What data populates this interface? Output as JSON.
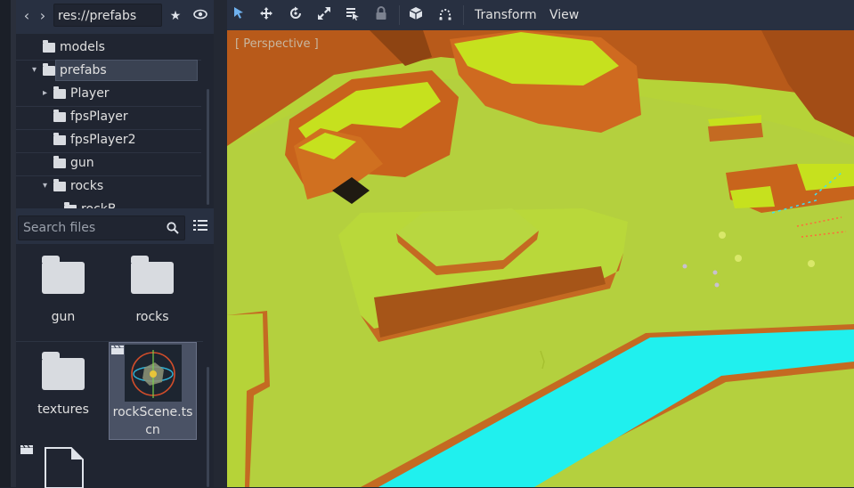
{
  "filesystem": {
    "path": "res://prefabs",
    "tree": [
      {
        "label": "models",
        "depth": 0,
        "expanded": null,
        "selected": false
      },
      {
        "label": "prefabs",
        "depth": 0,
        "expanded": true,
        "selected": true
      },
      {
        "label": "Player",
        "depth": 1,
        "expanded": false,
        "selected": false
      },
      {
        "label": "fpsPlayer",
        "depth": 1,
        "expanded": null,
        "selected": false
      },
      {
        "label": "fpsPlayer2",
        "depth": 1,
        "expanded": null,
        "selected": false
      },
      {
        "label": "gun",
        "depth": 1,
        "expanded": null,
        "selected": false
      },
      {
        "label": "rocks",
        "depth": 1,
        "expanded": true,
        "selected": false
      },
      {
        "label": "rockB",
        "depth": 2,
        "expanded": null,
        "selected": false
      }
    ],
    "search_placeholder": "Search files",
    "files": [
      {
        "label": "gun",
        "kind": "folder"
      },
      {
        "label": "rocks",
        "kind": "folder"
      },
      {
        "label": "textures",
        "kind": "folder"
      },
      {
        "label": "rockScene.tscn",
        "kind": "scene",
        "selected": true
      }
    ]
  },
  "toolbar": {
    "icons": [
      "select-icon",
      "move-icon",
      "rotate-icon",
      "scale-icon",
      "list-select-icon",
      "lock-icon",
      "cube-icon",
      "snap-icon"
    ],
    "menus": [
      "Transform",
      "View"
    ]
  },
  "viewport": {
    "label": "[ Perspective ]"
  },
  "colors": {
    "panel": "#283041",
    "panel_dark": "#202531",
    "selection": "#3a4252",
    "grass": "#b6d338",
    "grass_top": "#c9e21c",
    "cliff": "#c8641c",
    "water": "#20f0ee"
  }
}
